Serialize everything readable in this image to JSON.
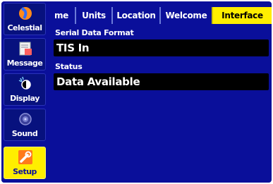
{
  "sidebar": {
    "items": [
      {
        "label": "Celestial",
        "icon": "celestial-icon"
      },
      {
        "label": "Message",
        "icon": "message-icon"
      },
      {
        "label": "Display",
        "icon": "display-icon"
      },
      {
        "label": "Sound",
        "icon": "sound-icon"
      },
      {
        "label": "Setup",
        "icon": "setup-wrench-icon",
        "active": true
      }
    ]
  },
  "tabs": [
    {
      "label": "me"
    },
    {
      "label": "Units"
    },
    {
      "label": "Location"
    },
    {
      "label": "Welcome"
    },
    {
      "label": "Interface",
      "active": true
    }
  ],
  "interface": {
    "serial_format_label": "Serial Data Format",
    "serial_format_value": "TIS In",
    "status_label": "Status",
    "status_value": "Data Available"
  },
  "colors": {
    "background": "#0a0f9a",
    "highlight": "#ffee00",
    "field": "#000000",
    "text": "#ffffff"
  }
}
